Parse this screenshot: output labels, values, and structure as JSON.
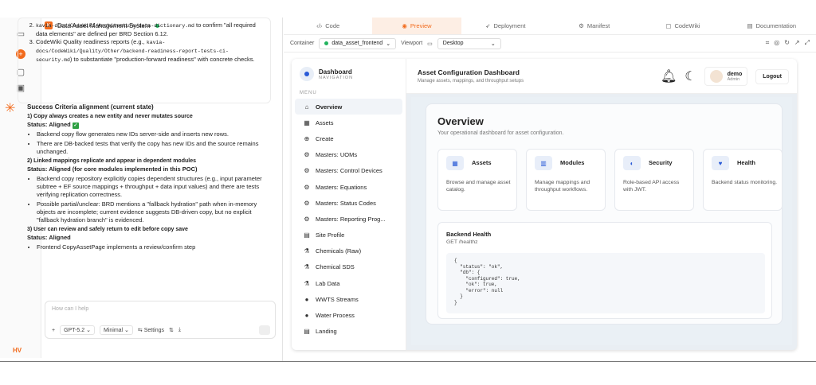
{
  "app": {
    "title": "Data Asset Management System",
    "status_color": "#22b35e",
    "accent": "#f26b1d"
  },
  "rail": {
    "icons": [
      "panel-icon",
      "add-icon",
      "chat-icon",
      "briefcase-icon"
    ],
    "user_initials": "HV"
  },
  "chat": {
    "card": {
      "item2_prefix": "kavia-docs/CodeWiki/Architecture/data-dictionary.md",
      "item2_text": "to confirm \"all required data elements\" are defined per BRD Section 6.12.",
      "item3_prefix": "CodeWiki Quality readiness reports (e.g.,",
      "item3_path": "kavia-docs/CodeWiki/Quality/Other/backend-readiness-report-tests-ci-security.md",
      "item3_text": ") to substantiate \"production-forward readiness\" with concrete checks."
    },
    "heading": "Success Criteria alignment (current state)",
    "s1_title": "1) Copy always creates a new entity and never mutates source",
    "s1_status": "Status: Aligned",
    "s1_b1": "Backend copy flow generates new IDs server-side and inserts new rows.",
    "s1_b2": "There are DB-backed tests that verify the copy has new IDs and the source remains unchanged.",
    "s2_title": "2) Linked mappings replicate and appear in dependent modules",
    "s2_status": "Status: Aligned (for core modules implemented in this POC)",
    "s2_b1": "Backend copy repository explicitly copies dependent structures (e.g., input parameter subtree + EF source mappings + throughput + data input values) and there are tests verifying replication correctness.",
    "s2_b2": "Possible partial/unclear: BRD mentions a \"fallback hydration\" path when in-memory objects are incomplete; current evidence suggests DB-driven copy, but no explicit \"fallback hydration branch\" is evidenced.",
    "s3_title": "3) User can review and safely return to edit before copy save",
    "s3_status": "Status: Aligned",
    "s3_b1": "Frontend CopyAssetPage implements a review/confirm step",
    "input_placeholder": "How can I help",
    "model": "GPT-5.2",
    "mode": "Minimal",
    "settings": "Settings"
  },
  "tabs": [
    {
      "label": "Code",
      "icon": "code-icon"
    },
    {
      "label": "Preview",
      "icon": "eye-icon"
    },
    {
      "label": "Deployment",
      "icon": "rocket-icon"
    },
    {
      "label": "Manifest",
      "icon": "gear-icon"
    },
    {
      "label": "CodeWiki",
      "icon": "book-icon"
    },
    {
      "label": "Documentation",
      "icon": "doc-icon"
    }
  ],
  "toolbar": {
    "container_label": "Container",
    "container_value": "data_asset_frontend",
    "viewport_label": "Viewport",
    "viewport_value": "Desktop"
  },
  "preview": {
    "brand": {
      "title": "Dashboard",
      "subtitle": "NAVIGATION"
    },
    "menu_label": "MENU",
    "menu": [
      {
        "label": "Overview",
        "icon": "home-icon",
        "glyph": "⌂"
      },
      {
        "label": "Assets",
        "icon": "table-icon",
        "glyph": "▦"
      },
      {
        "label": "Create",
        "icon": "plus-circle-icon",
        "glyph": "⊕"
      },
      {
        "label": "Masters: UOMs",
        "icon": "cogs-icon",
        "glyph": "⚙"
      },
      {
        "label": "Masters: Control Devices",
        "icon": "cogs-icon",
        "glyph": "⚙"
      },
      {
        "label": "Masters: Equations",
        "icon": "cogs-icon",
        "glyph": "⚙"
      },
      {
        "label": "Masters: Status Codes",
        "icon": "cogs-icon",
        "glyph": "⚙"
      },
      {
        "label": "Masters: Reporting Prog...",
        "icon": "cogs-icon",
        "glyph": "⚙"
      },
      {
        "label": "Site Profile",
        "icon": "building-icon",
        "glyph": "▤"
      },
      {
        "label": "Chemicals (Raw)",
        "icon": "flask-icon",
        "glyph": "⚗"
      },
      {
        "label": "Chemical SDS",
        "icon": "flask-icon",
        "glyph": "⚗"
      },
      {
        "label": "Lab Data",
        "icon": "flask-icon",
        "glyph": "⚗"
      },
      {
        "label": "WWTS Streams",
        "icon": "drop-icon",
        "glyph": "●"
      },
      {
        "label": "Water Process",
        "icon": "drop-icon",
        "glyph": "●"
      },
      {
        "label": "Landing",
        "icon": "building-icon",
        "glyph": "▤"
      }
    ],
    "header": {
      "title": "Asset Configuration Dashboard",
      "subtitle": "Manage assets, mappings, and throughput setups",
      "user": "demo",
      "role": "Admin",
      "logout": "Logout"
    },
    "overview": {
      "title": "Overview",
      "subtitle": "Your operational dashboard for asset configuration."
    },
    "tiles": [
      {
        "title": "Assets",
        "desc": "Browse and manage asset catalog.",
        "icon": "table-icon",
        "glyph": "▦"
      },
      {
        "title": "Modules",
        "desc": "Manage mappings and throughput workflows.",
        "icon": "chart-icon",
        "glyph": "▥"
      },
      {
        "title": "Security",
        "desc": "Role-based API access with JWT.",
        "icon": "shield-icon",
        "glyph": "◐"
      },
      {
        "title": "Health",
        "desc": "Backend status monitoring.",
        "icon": "heart-icon",
        "glyph": "♥"
      }
    ],
    "health": {
      "title": "Backend Health",
      "endpoint": "GET /healthz",
      "json": "{\n  \"status\": \"ok\",\n  \"db\": {\n    \"configured\": true,\n    \"ok\": true,\n    \"error\": null\n  }\n}"
    }
  }
}
